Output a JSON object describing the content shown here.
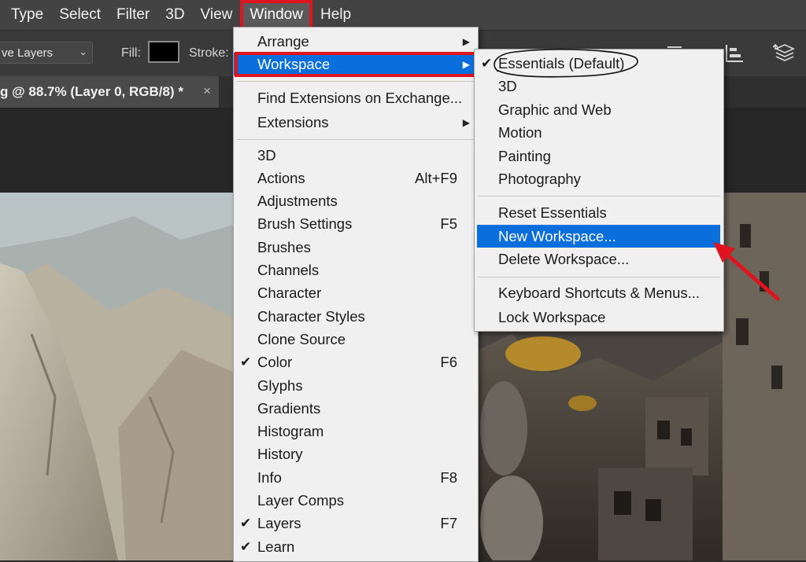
{
  "menubar": {
    "items": [
      "Type",
      "Select",
      "Filter",
      "3D",
      "View",
      "Window",
      "Help"
    ],
    "active": "Window"
  },
  "options_bar": {
    "sample_value": "ve Layers",
    "fill_label": "Fill:",
    "stroke_label": "Stroke:",
    "fill_color": "#000000"
  },
  "document_tab": {
    "title": "g @ 88.7% (Layer 0, RGB/8) *",
    "close": "×"
  },
  "window_menu": {
    "items": [
      {
        "label": "Arrange",
        "shortcut": "",
        "submenu": true,
        "checked": false
      },
      {
        "label": "Workspace",
        "shortcut": "",
        "submenu": true,
        "checked": false,
        "highlighted": true
      },
      {
        "label": "Find Extensions on Exchange...",
        "shortcut": "",
        "submenu": false,
        "checked": false
      },
      {
        "label": "Extensions",
        "shortcut": "",
        "submenu": true,
        "checked": false
      },
      {
        "label": "3D",
        "shortcut": "",
        "submenu": false,
        "checked": false
      },
      {
        "label": "Actions",
        "shortcut": "Alt+F9",
        "submenu": false,
        "checked": false
      },
      {
        "label": "Adjustments",
        "shortcut": "",
        "submenu": false,
        "checked": false
      },
      {
        "label": "Brush Settings",
        "shortcut": "F5",
        "submenu": false,
        "checked": false
      },
      {
        "label": "Brushes",
        "shortcut": "",
        "submenu": false,
        "checked": false
      },
      {
        "label": "Channels",
        "shortcut": "",
        "submenu": false,
        "checked": false
      },
      {
        "label": "Character",
        "shortcut": "",
        "submenu": false,
        "checked": false
      },
      {
        "label": "Character Styles",
        "shortcut": "",
        "submenu": false,
        "checked": false
      },
      {
        "label": "Clone Source",
        "shortcut": "",
        "submenu": false,
        "checked": false
      },
      {
        "label": "Color",
        "shortcut": "F6",
        "submenu": false,
        "checked": true
      },
      {
        "label": "Glyphs",
        "shortcut": "",
        "submenu": false,
        "checked": false
      },
      {
        "label": "Gradients",
        "shortcut": "",
        "submenu": false,
        "checked": false
      },
      {
        "label": "Histogram",
        "shortcut": "",
        "submenu": false,
        "checked": false
      },
      {
        "label": "History",
        "shortcut": "",
        "submenu": false,
        "checked": false
      },
      {
        "label": "Info",
        "shortcut": "F8",
        "submenu": false,
        "checked": false
      },
      {
        "label": "Layer Comps",
        "shortcut": "",
        "submenu": false,
        "checked": false
      },
      {
        "label": "Layers",
        "shortcut": "F7",
        "submenu": false,
        "checked": true
      },
      {
        "label": "Learn",
        "shortcut": "",
        "submenu": false,
        "checked": true
      }
    ]
  },
  "workspace_submenu": {
    "items": [
      {
        "label": "Essentials (Default)",
        "checked": true,
        "highlighted": false
      },
      {
        "label": "3D",
        "checked": false,
        "highlighted": false
      },
      {
        "label": "Graphic and Web",
        "checked": false,
        "highlighted": false
      },
      {
        "label": "Motion",
        "checked": false,
        "highlighted": false
      },
      {
        "label": "Painting",
        "checked": false,
        "highlighted": false
      },
      {
        "label": "Photography",
        "checked": false,
        "highlighted": false
      },
      {
        "label": "Reset Essentials",
        "checked": false,
        "highlighted": false
      },
      {
        "label": "New Workspace...",
        "checked": false,
        "highlighted": true
      },
      {
        "label": "Delete Workspace...",
        "checked": false,
        "highlighted": false
      },
      {
        "label": "Keyboard Shortcuts & Menus...",
        "checked": false,
        "highlighted": false
      },
      {
        "label": "Lock Workspace",
        "checked": false,
        "highlighted": false
      }
    ]
  },
  "colors": {
    "highlight": "#0a6fdc",
    "annotation_red": "#e0141e",
    "menu_bg": "#f0f0f0",
    "app_dark": "#434343"
  },
  "icons": {
    "check": "check-icon",
    "submenu": "submenu-arrow-icon",
    "dropdown": "chevron-down-icon",
    "close": "close-icon"
  }
}
